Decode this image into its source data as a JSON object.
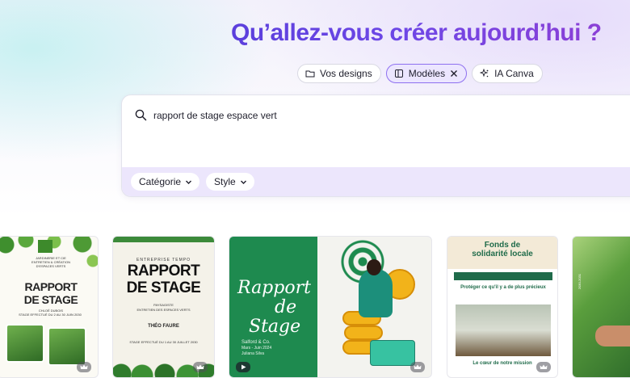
{
  "headline": "Qu’allez-vous créer aujourd’hui ?",
  "tabs": [
    {
      "label": "Vos designs",
      "icon": "folder-icon"
    },
    {
      "label": "Modèles",
      "icon": "template-icon",
      "active": true,
      "close_icon": "close-icon"
    },
    {
      "label": "IA Canva",
      "icon": "sparkle-icon"
    }
  ],
  "search": {
    "query": "rapport de stage espace vert",
    "icon": "search-icon"
  },
  "filters": [
    {
      "label": "Catégorie",
      "icon": "chevron-down-icon"
    },
    {
      "label": "Style",
      "icon": "chevron-down-icon"
    }
  ],
  "templates": [
    {
      "title_line1": "RAPPORT",
      "title_line2": "DE STAGE",
      "org_line1": "JARDINERIE ET CIE",
      "org_line2": "ENTRETIEN & CRÉATION",
      "org_line3": "D'ESPACES VERTS",
      "author": "CHLOÉ DUBOIS",
      "period": "STAGE EFFECTUÉ DU 2 AU 30 JUIN 2030",
      "badge": "crown-icon"
    },
    {
      "eyebrow": "ENTREPRISE TEMPO",
      "title_line1": "RAPPORT",
      "title_line2": "DE STAGE",
      "role_line1": "PAYSAGISTE",
      "role_line2": "ENTRETIEN DES ESPACES VERTS",
      "name": "THÉO FAURE",
      "period": "STAGE EFFECTUÉ DU 1 AU 30 JUILLET 2030",
      "badge": "crown-icon"
    },
    {
      "script_line1": "Rapport",
      "script_line2": "de",
      "script_line3": "Stage",
      "meta_line1": "Salford & Co.",
      "meta_line2": "Mars - Juin 2024",
      "meta_line3": "Juliana Silva",
      "badge": "play-icon",
      "badge2": "crown-icon"
    },
    {
      "title_line1": "Fonds de",
      "title_line2": "solidarité locale",
      "heading": "Protéger ce qu'il y a de plus précieux",
      "footer": "Le cœur de notre mission",
      "badge": "crown-icon"
    },
    {
      "year": "2030-2031"
    }
  ],
  "colors": {
    "accent": "#7d2ae8",
    "headline_start": "#5b3fdc",
    "filter_bar": "#ece6fc",
    "active_tab": "#ece6ff"
  }
}
